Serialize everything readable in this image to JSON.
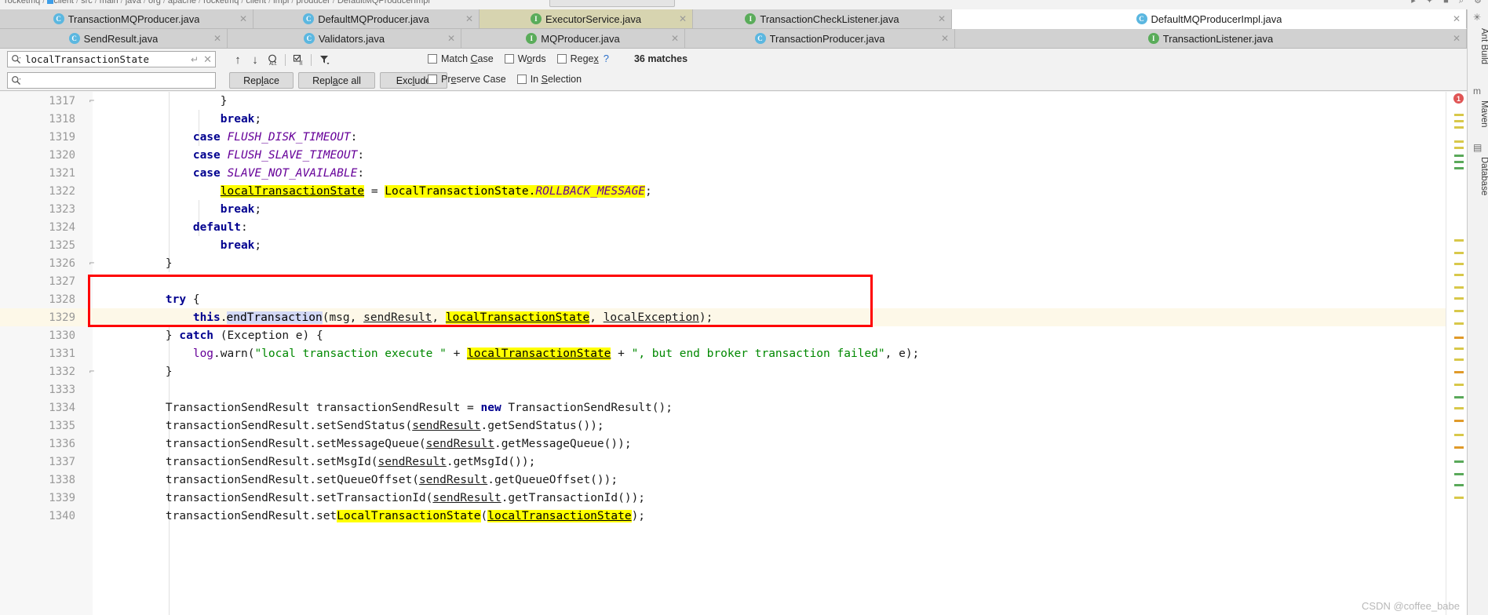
{
  "window": {
    "breadcrumb": [
      "rocketmq",
      "client",
      "src",
      "main",
      "java",
      "org",
      "apache",
      "rocketmq",
      "client",
      "impl",
      "producer",
      "DefaultMQProducerImpl"
    ],
    "watermark": "CSDN @coffee_babe"
  },
  "tabs": {
    "row1": [
      {
        "label": "TransactionMQProducer.java",
        "icon": "class-icon",
        "icon_letter": "C",
        "state": "inactive"
      },
      {
        "label": "DefaultMQProducer.java",
        "icon": "class-icon",
        "icon_letter": "C",
        "state": "inactive"
      },
      {
        "label": "ExecutorService.java",
        "icon": "interface-icon",
        "icon_letter": "I",
        "state": "highlighted"
      },
      {
        "label": "TransactionCheckListener.java",
        "icon": "interface-icon",
        "icon_letter": "I",
        "state": "inactive"
      },
      {
        "label": "DefaultMQProducerImpl.java",
        "icon": "class-icon",
        "icon_letter": "C",
        "state": "active"
      }
    ],
    "row2": [
      {
        "label": "SendResult.java",
        "icon": "class-icon",
        "icon_letter": "C",
        "state": "inactive"
      },
      {
        "label": "Validators.java",
        "icon": "class-icon",
        "icon_letter": "C",
        "state": "inactive"
      },
      {
        "label": "MQProducer.java",
        "icon": "interface-icon",
        "icon_letter": "I",
        "state": "inactive"
      },
      {
        "label": "TransactionProducer.java",
        "icon": "class-icon",
        "icon_letter": "C",
        "state": "inactive"
      },
      {
        "label": "TransactionListener.java",
        "icon": "interface-icon",
        "icon_letter": "I",
        "state": "inactive"
      }
    ]
  },
  "find_panel": {
    "search_value": "localTransactionState",
    "search_placeholder": "",
    "replace_value": "",
    "replace_placeholder": "",
    "matches_text": "36 matches",
    "buttons": [
      {
        "label": "Replace",
        "mnemonic": "l"
      },
      {
        "label": "Replace all",
        "mnemonic": "a"
      },
      {
        "label": "Exclude",
        "mnemonic": "l"
      }
    ],
    "checkboxes_row1": [
      {
        "label": "Match Case",
        "mnemonic": "C",
        "checked": false
      },
      {
        "label": "Words",
        "mnemonic": "o",
        "checked": false
      },
      {
        "label": "Regex",
        "mnemonic": "x",
        "checked": false
      }
    ],
    "checkboxes_row2": [
      {
        "label": "Preserve Case",
        "mnemonic": "e",
        "checked": false
      },
      {
        "label": "In Selection",
        "mnemonic": "S",
        "checked": false
      }
    ],
    "help_label": "?",
    "nav_icons": [
      "find-previous-icon",
      "find-next-icon",
      "select-all-occurrences-icon",
      "toggle-in-comments-icon",
      "filter-icon"
    ]
  },
  "editor": {
    "first_line_number": 1317,
    "current_line": 1329,
    "lines": [
      {
        "n": 1317,
        "fold": "-",
        "text": "            }"
      },
      {
        "n": 1318,
        "fold": "",
        "text": "            break;"
      },
      {
        "n": 1319,
        "fold": "",
        "text": "        case FLUSH_DISK_TIMEOUT:"
      },
      {
        "n": 1320,
        "fold": "",
        "text": "        case FLUSH_SLAVE_TIMEOUT:"
      },
      {
        "n": 1321,
        "fold": "",
        "text": "        case SLAVE_NOT_AVAILABLE:"
      },
      {
        "n": 1322,
        "fold": "",
        "text": "            localTransactionState = LocalTransactionState.ROLLBACK_MESSAGE;"
      },
      {
        "n": 1323,
        "fold": "",
        "text": "            break;"
      },
      {
        "n": 1324,
        "fold": "",
        "text": "        default:"
      },
      {
        "n": 1325,
        "fold": "",
        "text": "            break;"
      },
      {
        "n": 1326,
        "fold": "-",
        "text": "    }"
      },
      {
        "n": 1327,
        "fold": "",
        "text": ""
      },
      {
        "n": 1328,
        "fold": "",
        "text": "    try {"
      },
      {
        "n": 1329,
        "fold": "",
        "text": "        this.endTransaction(msg, sendResult, localTransactionState, localException);"
      },
      {
        "n": 1330,
        "fold": "",
        "text": "    } catch (Exception e) {"
      },
      {
        "n": 1331,
        "fold": "",
        "text": "        log.warn(\"local transaction execute \" + localTransactionState + \", but end broker transaction failed\", e);"
      },
      {
        "n": 1332,
        "fold": "-",
        "text": "    }"
      },
      {
        "n": 1333,
        "fold": "",
        "text": ""
      },
      {
        "n": 1334,
        "fold": "",
        "text": "    TransactionSendResult transactionSendResult = new TransactionSendResult();"
      },
      {
        "n": 1335,
        "fold": "",
        "text": "    transactionSendResult.setSendStatus(sendResult.getSendStatus());"
      },
      {
        "n": 1336,
        "fold": "",
        "text": "    transactionSendResult.setMessageQueue(sendResult.getMessageQueue());"
      },
      {
        "n": 1337,
        "fold": "",
        "text": "    transactionSendResult.setMsgId(sendResult.getMsgId());"
      },
      {
        "n": 1338,
        "fold": "",
        "text": "    transactionSendResult.setQueueOffset(sendResult.getQueueOffset());"
      },
      {
        "n": 1339,
        "fold": "",
        "text": "    transactionSendResult.setTransactionId(sendResult.getTransactionId());"
      },
      {
        "n": 1340,
        "fold": "",
        "text": "    transactionSendResult.setLocalTransactionState(localTransactionState);"
      }
    ],
    "highlight_term": "localTransactionState",
    "highlight_color": "#ffff00",
    "selection_text": "endTransaction",
    "selection_color": "#d3d9f7",
    "current_line_color": "#fdf8e8",
    "annotation_box_color": "#ff0000"
  },
  "right_toolbar": {
    "error_count": "1",
    "items": [
      {
        "label": "Ant Build",
        "name": "tool-window-ant-build"
      },
      {
        "label": "Maven",
        "name": "tool-window-maven"
      },
      {
        "label": "Database",
        "name": "tool-window-database"
      }
    ]
  }
}
